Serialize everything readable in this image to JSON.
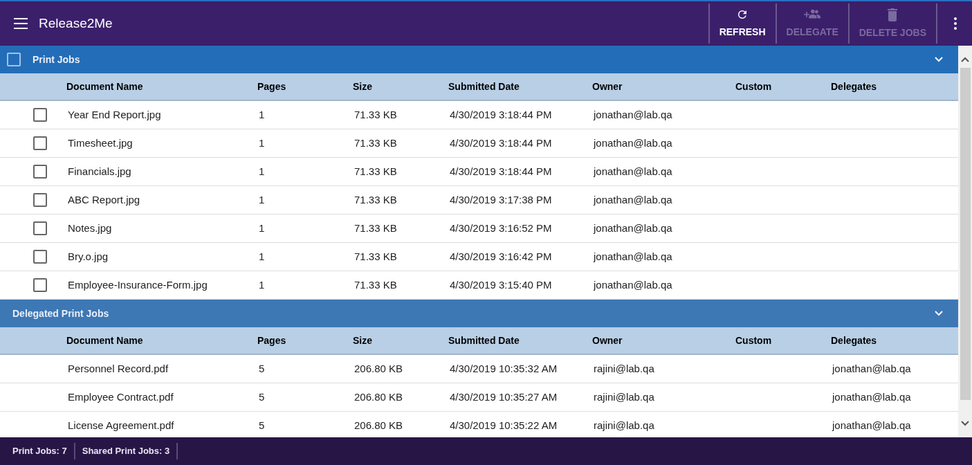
{
  "app_bar": {
    "title": "Release2Me",
    "actions": [
      {
        "kind": "refresh",
        "label": "REFRESH",
        "disabled": false
      },
      {
        "kind": "delegate",
        "label": "DELEGATE",
        "disabled": true
      },
      {
        "kind": "delete",
        "label": "DELETE JOBS",
        "disabled": true
      }
    ]
  },
  "sections": [
    {
      "title": "Print Jobs",
      "select_all_checked": false,
      "expanded": true,
      "columns": [
        "Document Name",
        "Pages",
        "Size",
        "Submitted Date",
        "Owner",
        "Custom",
        "Delegates"
      ],
      "rows": [
        {
          "checked": false,
          "cells": [
            "Year End Report.jpg",
            "1",
            "71.33 KB",
            "4/30/2019 3:18:44 PM",
            "jonathan@lab.qa",
            "",
            ""
          ]
        },
        {
          "checked": false,
          "cells": [
            "Timesheet.jpg",
            "1",
            "71.33 KB",
            "4/30/2019 3:18:44 PM",
            "jonathan@lab.qa",
            "",
            ""
          ]
        },
        {
          "checked": false,
          "cells": [
            "Financials.jpg",
            "1",
            "71.33 KB",
            "4/30/2019 3:18:44 PM",
            "jonathan@lab.qa",
            "",
            ""
          ]
        },
        {
          "checked": false,
          "cells": [
            "ABC Report.jpg",
            "1",
            "71.33 KB",
            "4/30/2019 3:17:38 PM",
            "jonathan@lab.qa",
            "",
            ""
          ]
        },
        {
          "checked": false,
          "cells": [
            "Notes.jpg",
            "1",
            "71.33 KB",
            "4/30/2019 3:16:52 PM",
            "jonathan@lab.qa",
            "",
            ""
          ]
        },
        {
          "checked": false,
          "cells": [
            "Bry.o.jpg",
            "1",
            "71.33 KB",
            "4/30/2019 3:16:42 PM",
            "jonathan@lab.qa",
            "",
            ""
          ]
        },
        {
          "checked": false,
          "cells": [
            "Employee-Insurance-Form.jpg",
            "1",
            "71.33 KB",
            "4/30/2019 3:15:40 PM",
            "jonathan@lab.qa",
            "",
            ""
          ]
        }
      ]
    },
    {
      "title": "Delegated Print Jobs",
      "expanded": true,
      "columns": [
        "Document Name",
        "Pages",
        "Size",
        "Submitted Date",
        "Owner",
        "Custom",
        "Delegates"
      ],
      "rows": [
        {
          "cells": [
            "Personnel Record.pdf",
            "5",
            "206.80 KB",
            "4/30/2019 10:35:32 AM",
            "rajini@lab.qa",
            "",
            "jonathan@lab.qa"
          ]
        },
        {
          "cells": [
            "Employee Contract.pdf",
            "5",
            "206.80 KB",
            "4/30/2019 10:35:27 AM",
            "rajini@lab.qa",
            "",
            "jonathan@lab.qa"
          ]
        },
        {
          "cells": [
            "License Agreement.pdf",
            "5",
            "206.80 KB",
            "4/30/2019 10:35:22 AM",
            "rajini@lab.qa",
            "",
            "jonathan@lab.qa"
          ]
        }
      ]
    }
  ],
  "status_bar": [
    "Print Jobs: 7",
    "Shared Print Jobs: 3"
  ]
}
